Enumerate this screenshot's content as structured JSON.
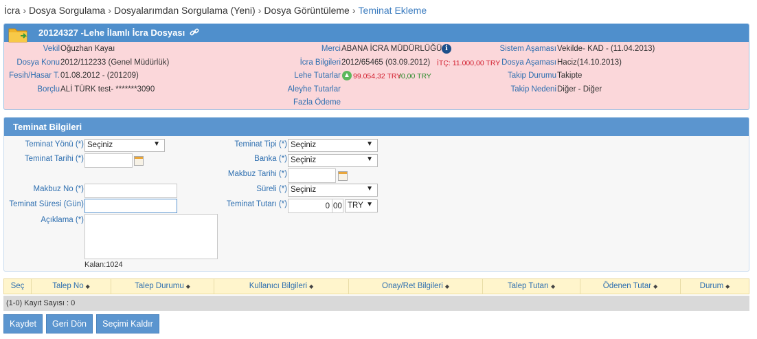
{
  "breadcrumb": {
    "items": [
      "İcra",
      "Dosya Sorgulama",
      "Dosyalarımdan Sorgulama (Yeni)",
      "Dosya Görüntüleme"
    ],
    "current": "Teminat Ekleme",
    "separator": "›"
  },
  "file": {
    "title": "20124327 -Lehe İlamlı İcra Dosyası",
    "vekil_label": "Vekil",
    "vekil_value": "Oğuzhan Kayaı",
    "dosya_konu_label": "Dosya Konu",
    "dosya_konu_value": "2012/112233 (Genel Müdürlük)",
    "fesih_label": "Fesih/Hasar T.",
    "fesih_value": "01.08.2012 - (201209)",
    "borclu_label": "Borçlu",
    "borclu_value": "ALİ TÜRK test- *******3090",
    "merci_label": "Merci",
    "merci_value": "ABANA İCRA MÜDÜRLÜĞÜ",
    "icra_bilgileri_label": "İcra Bilgileri",
    "icra_bilgileri_value": "2012/65465 (03.09.2012)",
    "itc_value": "İTÇ:  11.000,00 TRY",
    "lehe_label": "Lehe Tutarlar",
    "lehe_value_red": "99.054,32 TRY",
    "lehe_value_green": "/0,00 TRY",
    "aleyhe_label": "Aleyhe Tutarlar",
    "fazla_label": "Fazla Ödeme",
    "sistem_label": "Sistem Aşaması",
    "sistem_value": "Vekilde- KAD - (11.04.2013)",
    "dosya_asamasi_label": "Dosya Aşaması",
    "dosya_asamasi_value": "Haciz(14.10.2013)",
    "takip_durumu_label": "Takip Durumu",
    "takip_durumu_value": "Takipte",
    "takip_nedeni_label": "Takip Nedeni",
    "takip_nedeni_value": "Diğer - Diğer"
  },
  "teminat": {
    "header": "Teminat Bilgileri",
    "yonu_label": "Teminat Yönü (*)",
    "yonu_value": "Seçiniz",
    "tarihi_label": "Teminat Tarihi (*)",
    "tarihi_value": "",
    "makbuz_no_label": "Makbuz No (*)",
    "makbuz_no_value": "",
    "suresi_label": "Teminat Süresi (Gün)",
    "suresi_value": "",
    "aciklama_label": "Açıklama (*)",
    "kalan": "Kalan:1024",
    "tipi_label": "Teminat Tipi (*)",
    "tipi_value": "Seçiniz",
    "banka_label": "Banka (*)",
    "banka_value": "Seçiniz",
    "makbuz_tarihi_label": "Makbuz Tarihi (*)",
    "makbuz_tarihi_value": "",
    "sureli_label": "Süreli (*)",
    "sureli_value": "Seçiniz",
    "tutari_label": "Teminat Tutarı (*)",
    "tutari_int": "0",
    "tutari_dec": "00",
    "currency": "TRY"
  },
  "grid": {
    "columns": [
      "Seç",
      "Talep No",
      "Talep Durumu",
      "Kullanıcı Bilgileri",
      "Onay/Ret Bilgileri",
      "Talep Tutarı",
      "Ödenen Tutar",
      "Durum"
    ],
    "footer": "(1-0) Kayıt Sayısı : 0"
  },
  "buttons": {
    "save": "Kaydet",
    "back": "Geri Dön",
    "clear": "Seçimi Kaldır"
  },
  "colors": {
    "header_blue": "#4f8fcc",
    "pink_bg": "#fbd7da",
    "link_blue": "#2e6fb0"
  },
  "icons": [
    "folder-icon",
    "link-icon",
    "info-icon",
    "arrow-up-icon",
    "calendar-icon",
    "chevron-down-icon",
    "sort-icon"
  ]
}
